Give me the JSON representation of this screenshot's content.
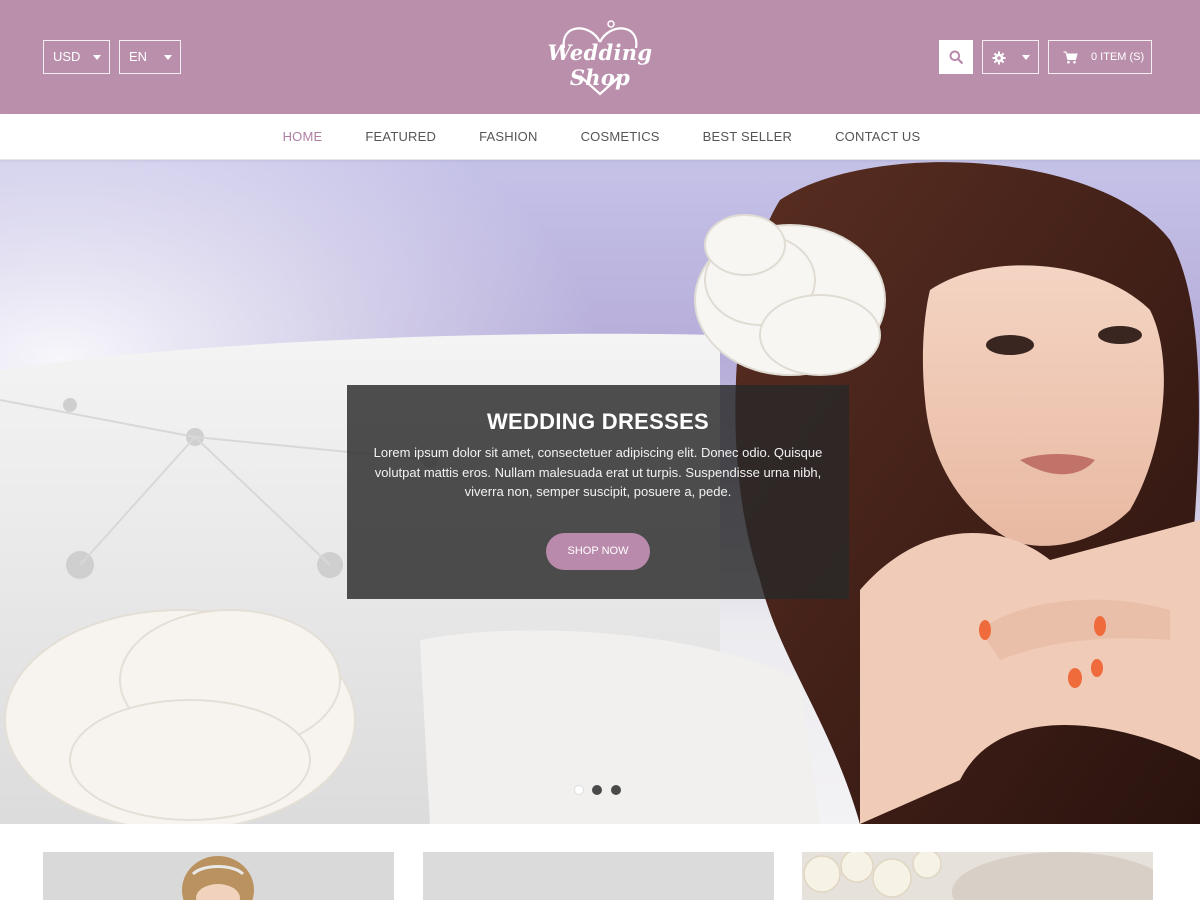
{
  "header": {
    "currency": "USD",
    "language": "EN",
    "logo_text": "Wedding Shop",
    "cart_label": "0 ITEM (S)",
    "bg_color": "#ba8fac"
  },
  "nav": {
    "items": [
      {
        "label": "HOME",
        "active": true
      },
      {
        "label": "FEATURED",
        "active": false
      },
      {
        "label": "FASHION",
        "active": false
      },
      {
        "label": "COSMETICS",
        "active": false
      },
      {
        "label": "BEST SELLER",
        "active": false
      },
      {
        "label": "CONTACT US",
        "active": false
      }
    ],
    "active_color": "#b07fa4"
  },
  "hero": {
    "title": "WEDDING DRESSES",
    "text": "Lorem ipsum dolor sit amet, consectetuer adipiscing elit. Donec odio. Quisque volutpat mattis eros. Nullam malesuada erat ut turpis. Suspendisse urna nibh, viverra non, semper suscipit, posuere a, pede.",
    "button_label": "SHOP NOW",
    "slide_count": 3,
    "active_slide": 1
  },
  "icons": {
    "search": "search-icon",
    "settings": "gear-icon",
    "cart": "cart-icon"
  }
}
